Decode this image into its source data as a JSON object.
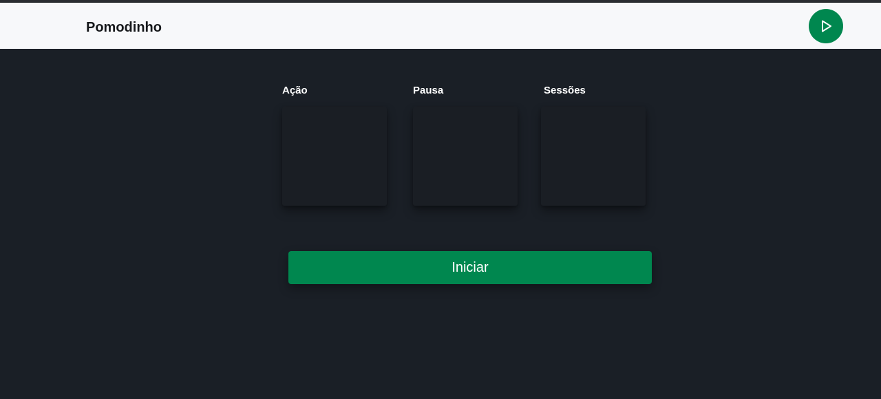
{
  "app": {
    "brand": "Pomodinho",
    "play_icon": "play-icon",
    "accent_color": "#00874f",
    "background_color": "#1a1f26",
    "navbar_color": "#f7f8fa"
  },
  "sections": [
    {
      "label": "Ação",
      "value": ""
    },
    {
      "label": "Pausa",
      "value": ""
    },
    {
      "label": "Sessões",
      "value": ""
    }
  ],
  "actions": {
    "start_label": "Iniciar"
  }
}
